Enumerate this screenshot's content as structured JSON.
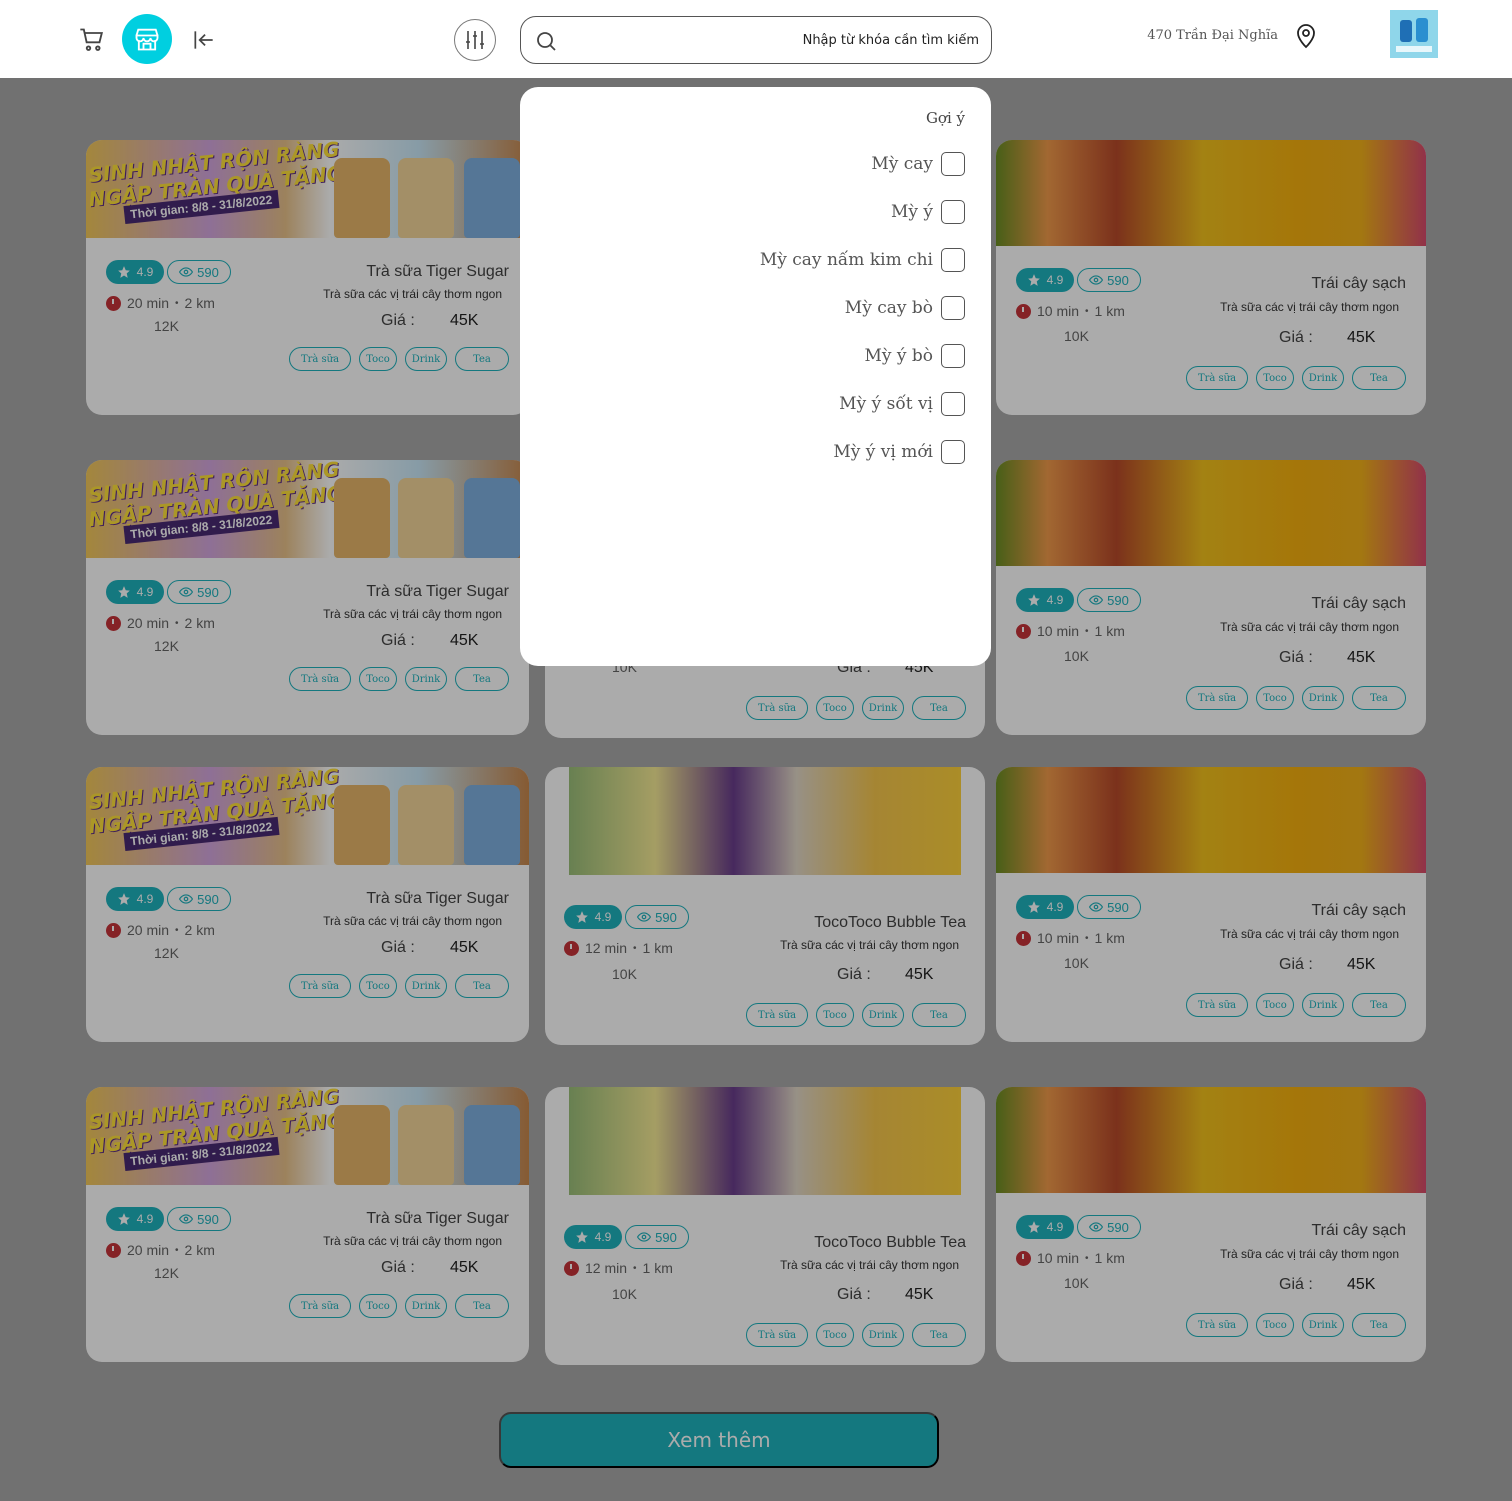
{
  "header": {
    "search_placeholder": "Nhập từ khóa cần tìm kiếm",
    "address": "470 Trần Đại Nghĩa",
    "accent_color": "#00cfe0"
  },
  "suggestions": {
    "title": "Gợi ý",
    "items": [
      "Mỳ cay",
      "Mỳ ý",
      "Mỳ cay nấm kim chi",
      "Mỳ cay bò",
      "Mỳ ý bò",
      "Mỳ ý sốt vị",
      "Mỳ ý vị mới"
    ]
  },
  "cards": {
    "tiger": {
      "banner_line1": "SINH NHẬT RỘN RÀNG",
      "banner_line2": "NGẬP TRÀN QUÀ TẶNG",
      "banner_date": "Thời gian: 8/8 - 31/8/2022",
      "rating": "4.9",
      "views": "590",
      "time": "20 min",
      "distance": "2 km",
      "min_price": "12K",
      "name": "Trà sữa Tiger Sugar",
      "desc": "Trà sữa các vị trái cây thơm ngon",
      "price_label": "Giá :",
      "price": "45K",
      "tags": [
        "Trà sữa",
        "Toco",
        "Drink",
        "Tea"
      ]
    },
    "toco": {
      "rating": "4.9",
      "views": "590",
      "time": "12 min",
      "distance": "1 km",
      "min_price": "10K",
      "name": "TocoToco Bubble Tea",
      "desc": "Trà sữa các vị trái cây thơm ngon",
      "price_label": "Giá :",
      "price": "45K",
      "tags": [
        "Trà sữa",
        "Toco",
        "Drink",
        "Tea"
      ]
    },
    "fruit": {
      "rating": "4.9",
      "views": "590",
      "time": "10 min",
      "distance": "1 km",
      "min_price": "10K",
      "name": "Trái cây sạch",
      "desc": "Trà sữa các vị trái cây thơm ngon",
      "price_label": "Giá :",
      "price": "45K",
      "tags": [
        "Trà sữa",
        "Toco",
        "Drink",
        "Tea"
      ]
    }
  },
  "more_button": "Xem thêm",
  "icons": [
    "cart-icon",
    "store-icon",
    "logout-icon",
    "filter-icon",
    "search-icon",
    "location-pin-icon",
    "star-icon",
    "eye-icon",
    "clock-icon"
  ]
}
